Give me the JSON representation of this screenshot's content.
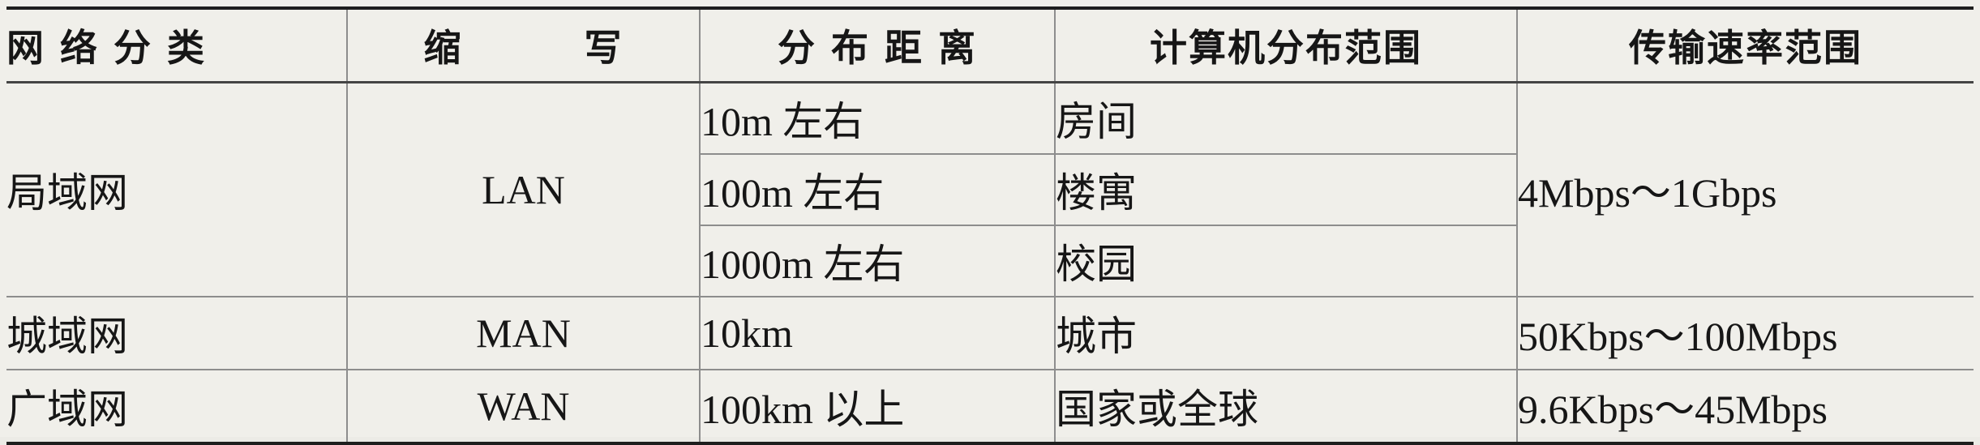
{
  "table": {
    "headers": {
      "category": "网 络 分 类",
      "abbr_left": "缩",
      "abbr_right": "写",
      "distance": "分 布 距 离",
      "range": "计算机分布范围",
      "rate": "传输速率范围"
    },
    "lan": {
      "category": "局域网",
      "abbr": "LAN",
      "rate": "4Mbps～1Gbps",
      "sub_rows": [
        {
          "distance": "10m 左右",
          "range": "房间"
        },
        {
          "distance": "100m 左右",
          "range": "楼寓"
        },
        {
          "distance": "1000m 左右",
          "range": "校园"
        }
      ]
    },
    "man": {
      "category": "城域网",
      "abbr": "MAN",
      "distance": "10km",
      "range": "城市",
      "rate": "50Kbps～100Mbps"
    },
    "wan": {
      "category": "广域网",
      "abbr": "WAN",
      "distance": "100km 以上",
      "range": "国家或全球",
      "rate": "9.6Kbps～45Mbps"
    }
  }
}
